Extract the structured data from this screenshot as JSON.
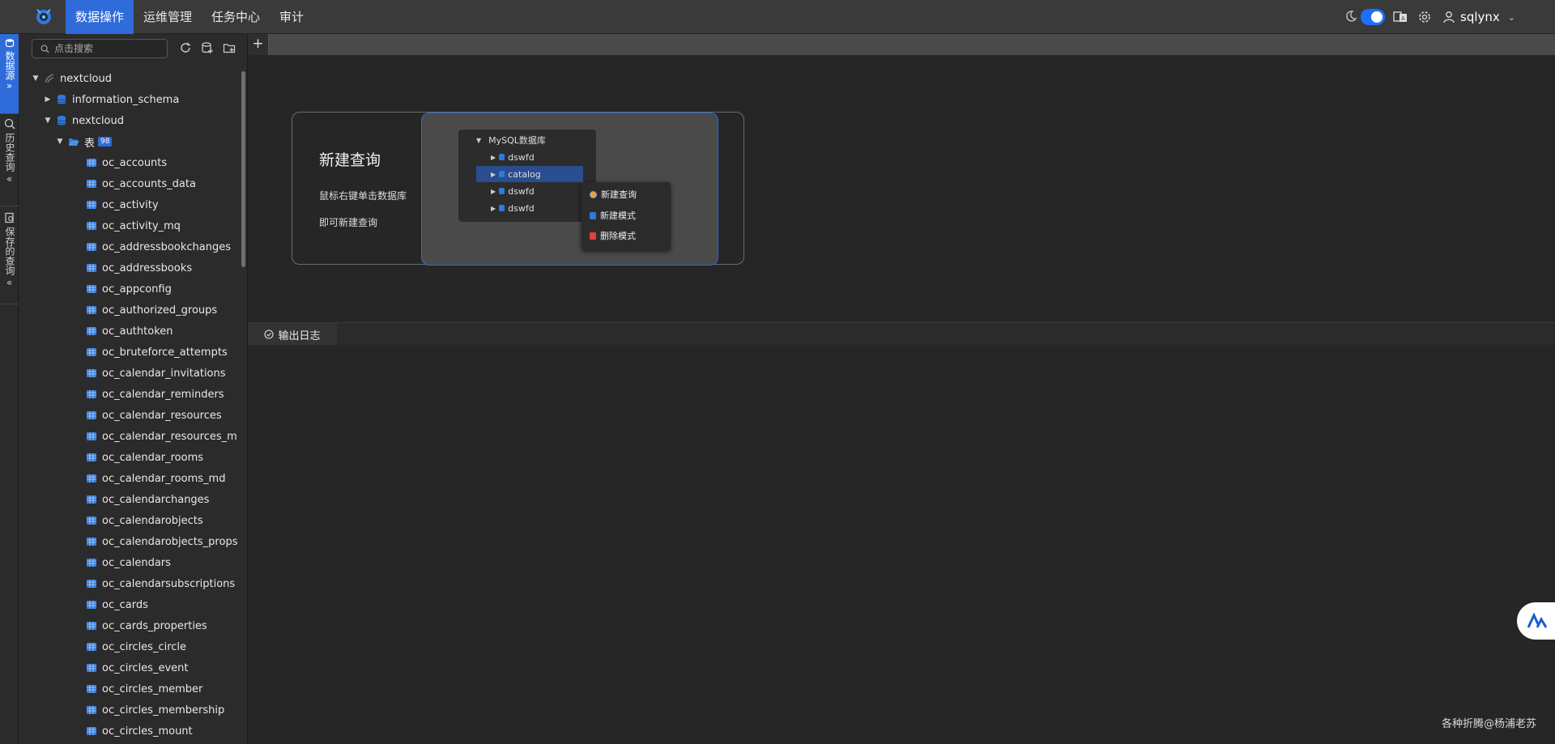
{
  "nav": {
    "items": [
      "数据操作",
      "运维管理",
      "任务中心",
      "审计"
    ],
    "active_index": 0
  },
  "user": {
    "name": "sqlynx"
  },
  "theme_toggle_on": true,
  "rail": {
    "tabs": [
      "数据源",
      "历史查询",
      "保存的查询"
    ]
  },
  "sidebar": {
    "search_placeholder": "点击搜索",
    "tree": {
      "root": "nextcloud",
      "schemas": [
        "information_schema",
        "nextcloud"
      ],
      "tables_label": "表",
      "tables_count": "98",
      "tables": [
        "oc_accounts",
        "oc_accounts_data",
        "oc_activity",
        "oc_activity_mq",
        "oc_addressbookchanges",
        "oc_addressbooks",
        "oc_appconfig",
        "oc_authorized_groups",
        "oc_authtoken",
        "oc_bruteforce_attempts",
        "oc_calendar_invitations",
        "oc_calendar_reminders",
        "oc_calendar_resources",
        "oc_calendar_resources_md",
        "oc_calendar_rooms",
        "oc_calendar_rooms_md",
        "oc_calendarchanges",
        "oc_calendarobjects",
        "oc_calendarobjects_props",
        "oc_calendars",
        "oc_calendarsubscriptions",
        "oc_cards",
        "oc_cards_properties",
        "oc_circles_circle",
        "oc_circles_event",
        "oc_circles_member",
        "oc_circles_membership",
        "oc_circles_mount"
      ]
    }
  },
  "guide": {
    "title": "新建查询",
    "line1": "鼠标右键单击数据库",
    "line2": "即可新建查询",
    "mini_tree": {
      "root": "MySQL数据库",
      "items": [
        "dswfd",
        "catalog",
        "dswfd",
        "dswfd"
      ]
    },
    "mini_menu": [
      "新建查询",
      "新建模式",
      "删除模式"
    ]
  },
  "log": {
    "tab_label": "输出日志"
  },
  "watermark": "各种折腾@杨浦老苏",
  "colors": {
    "accent": "#2f6bd9",
    "background": "#262626",
    "panel": "#2b2b2b"
  }
}
